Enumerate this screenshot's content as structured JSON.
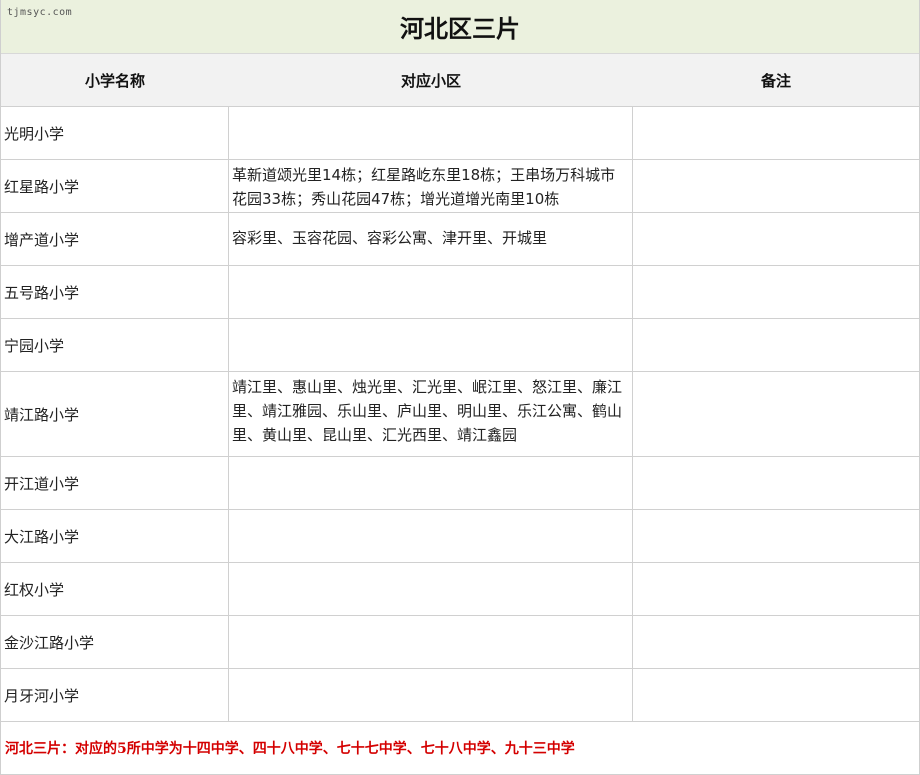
{
  "watermark": "tjmsyc.com",
  "title": "河北区三片",
  "headers": {
    "school": "小学名称",
    "area": "对应小区",
    "note": "备注"
  },
  "rows": [
    {
      "school": "光明小学",
      "area": "",
      "note": ""
    },
    {
      "school": "红星路小学",
      "area": "革新道颂光里14栋；红星路屹东里18栋；王串场万科城市花园33栋；秀山花园47栋；增光道增光南里10栋",
      "note": ""
    },
    {
      "school": "增产道小学",
      "area": "容彩里、玉容花园、容彩公寓、津开里、开城里",
      "note": ""
    },
    {
      "school": "五号路小学",
      "area": "",
      "note": ""
    },
    {
      "school": "宁园小学",
      "area": "",
      "note": ""
    },
    {
      "school": "靖江路小学",
      "area": "靖江里、惠山里、烛光里、汇光里、岷江里、怒江里、廉江里、靖江雅园、乐山里、庐山里、明山里、乐江公寓、鹤山里、黄山里、昆山里、汇光西里、靖江鑫园",
      "note": ""
    },
    {
      "school": "开江道小学",
      "area": "",
      "note": ""
    },
    {
      "school": "大江路小学",
      "area": "",
      "note": ""
    },
    {
      "school": "红权小学",
      "area": "",
      "note": ""
    },
    {
      "school": "金沙江路小学",
      "area": "",
      "note": ""
    },
    {
      "school": "月牙河小学",
      "area": "",
      "note": ""
    }
  ],
  "footer": "河北三片：对应的5所中学为十四中学、四十八中学、七十七中学、七十八中学、九十三中学"
}
